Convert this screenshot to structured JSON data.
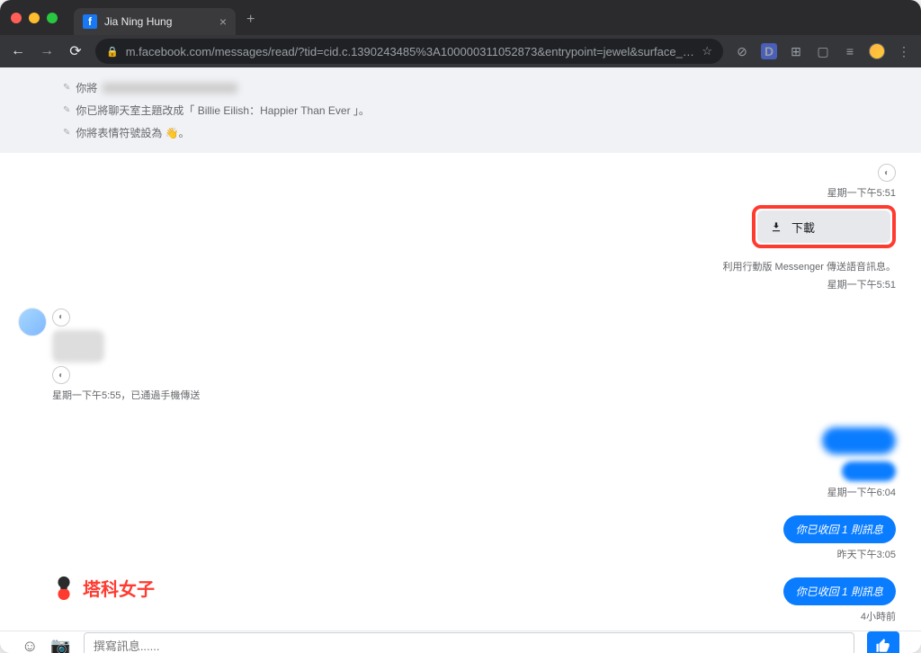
{
  "browser": {
    "tab_title": "Jia Ning Hung",
    "url": "m.facebook.com/messages/read/?tid=cid.c.1390243485%3A100000311052873&entrypoint=jewel&surface_hierarchy=..."
  },
  "system_messages": {
    "row1_prefix": "你將",
    "row2": "你已將聊天室主題改成「 Billie Eilish：Happier Than Ever 」。",
    "row3": "你將表情符號設為 👋。"
  },
  "chat": {
    "time1": "星期一下午5:51",
    "download_label": "下載",
    "voice_info": "利用行動版 Messenger 傳送語音訊息。",
    "time2": "星期一下午5:51",
    "left_meta": "星期一下午5:55，已通過手機傳送",
    "time3": "星期一下午6:04",
    "recall1": "你已收回 1 則訊息",
    "time4": "昨天下午3:05",
    "recall2": "你已收回 1 則訊息",
    "time5": "4小時前"
  },
  "watermark": {
    "text": "塔科女子"
  },
  "composer": {
    "placeholder": "撰寫訊息......"
  }
}
